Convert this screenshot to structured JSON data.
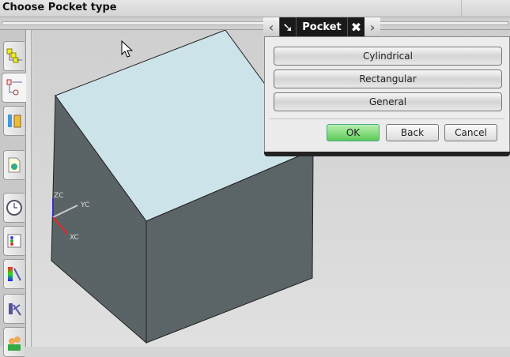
{
  "cue_line": "Choose Pocket type",
  "dialog": {
    "title": "Pocket",
    "options": [
      "Cylindrical",
      "Rectangular",
      "General"
    ],
    "ok_label": "OK",
    "back_label": "Back",
    "cancel_label": "Cancel",
    "ok_color": "#6fd66a"
  },
  "triad": {
    "z": "ZC",
    "y": "YC",
    "x": "XC"
  },
  "resource_tabs": [
    "assembly-navigator",
    "part-navigator",
    "reuse-library",
    "web-browser",
    "history",
    "system-materials",
    "visualization",
    "roles-manager",
    "roles"
  ]
}
